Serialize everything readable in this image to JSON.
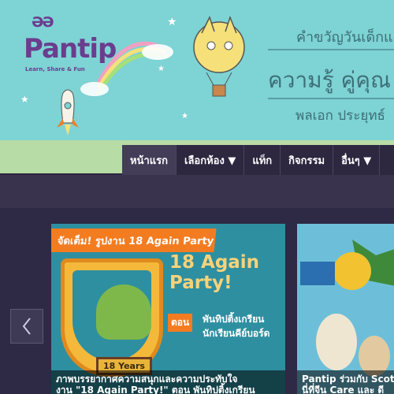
{
  "logo": {
    "glyph": "ƏƏ",
    "name": "Pantip",
    "tagline": "Learn, Share & Fun"
  },
  "header": {
    "welcome": "คำขวัญวันเด็กแ",
    "headline": "ความรู้ คู่คุณ",
    "subline": "พลเอก ประยุทธ์"
  },
  "nav": {
    "items": [
      "หน้าแรก",
      "เลือกห้อง ▼",
      "แท็ก",
      "กิจกรรม",
      "อื่นๆ ▼"
    ]
  },
  "slides": [
    {
      "banner": "จัดเต็ม! รูปงาน 18 Again Party",
      "title_line1": "18 Again",
      "title_line2": "Party!",
      "episode_badge": "ตอน",
      "episode_line1": "พันทิปติ้งเกรียน",
      "episode_line2": "นักเรียนคีย์บอร์ด",
      "years": "18 Years",
      "caption_line1": "ภาพบรรยากาศความสนุกและความประทับใจ",
      "caption_line2": "งาน \"18 Again Party!\" ตอน พันทิปติ้งเกรียน"
    },
    {
      "caption_line1": "Pantip ร่วมกับ Scott",
      "caption_line2": "นี่ที่จีน Care และ ดี"
    }
  ],
  "carousel": {
    "prev_icon": "chevron-left-icon"
  }
}
